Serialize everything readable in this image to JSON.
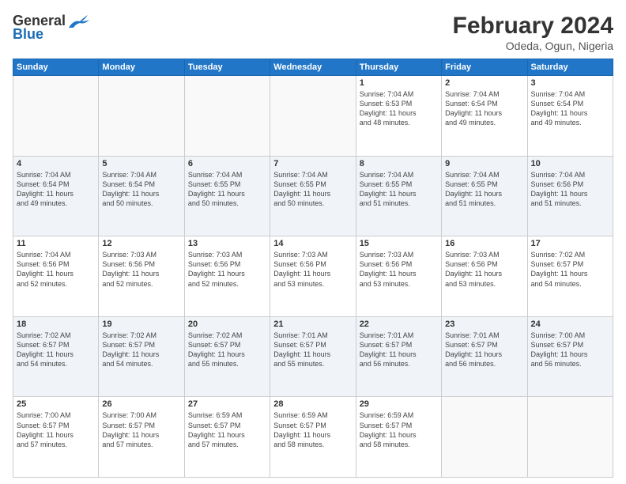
{
  "header": {
    "logo_general": "General",
    "logo_blue": "Blue",
    "title": "February 2024",
    "location": "Odeda, Ogun, Nigeria"
  },
  "weekdays": [
    "Sunday",
    "Monday",
    "Tuesday",
    "Wednesday",
    "Thursday",
    "Friday",
    "Saturday"
  ],
  "weeks": [
    [
      {
        "day": "",
        "info": ""
      },
      {
        "day": "",
        "info": ""
      },
      {
        "day": "",
        "info": ""
      },
      {
        "day": "",
        "info": ""
      },
      {
        "day": "1",
        "info": "Sunrise: 7:04 AM\nSunset: 6:53 PM\nDaylight: 11 hours\nand 48 minutes."
      },
      {
        "day": "2",
        "info": "Sunrise: 7:04 AM\nSunset: 6:54 PM\nDaylight: 11 hours\nand 49 minutes."
      },
      {
        "day": "3",
        "info": "Sunrise: 7:04 AM\nSunset: 6:54 PM\nDaylight: 11 hours\nand 49 minutes."
      }
    ],
    [
      {
        "day": "4",
        "info": "Sunrise: 7:04 AM\nSunset: 6:54 PM\nDaylight: 11 hours\nand 49 minutes."
      },
      {
        "day": "5",
        "info": "Sunrise: 7:04 AM\nSunset: 6:54 PM\nDaylight: 11 hours\nand 50 minutes."
      },
      {
        "day": "6",
        "info": "Sunrise: 7:04 AM\nSunset: 6:55 PM\nDaylight: 11 hours\nand 50 minutes."
      },
      {
        "day": "7",
        "info": "Sunrise: 7:04 AM\nSunset: 6:55 PM\nDaylight: 11 hours\nand 50 minutes."
      },
      {
        "day": "8",
        "info": "Sunrise: 7:04 AM\nSunset: 6:55 PM\nDaylight: 11 hours\nand 51 minutes."
      },
      {
        "day": "9",
        "info": "Sunrise: 7:04 AM\nSunset: 6:55 PM\nDaylight: 11 hours\nand 51 minutes."
      },
      {
        "day": "10",
        "info": "Sunrise: 7:04 AM\nSunset: 6:56 PM\nDaylight: 11 hours\nand 51 minutes."
      }
    ],
    [
      {
        "day": "11",
        "info": "Sunrise: 7:04 AM\nSunset: 6:56 PM\nDaylight: 11 hours\nand 52 minutes."
      },
      {
        "day": "12",
        "info": "Sunrise: 7:03 AM\nSunset: 6:56 PM\nDaylight: 11 hours\nand 52 minutes."
      },
      {
        "day": "13",
        "info": "Sunrise: 7:03 AM\nSunset: 6:56 PM\nDaylight: 11 hours\nand 52 minutes."
      },
      {
        "day": "14",
        "info": "Sunrise: 7:03 AM\nSunset: 6:56 PM\nDaylight: 11 hours\nand 53 minutes."
      },
      {
        "day": "15",
        "info": "Sunrise: 7:03 AM\nSunset: 6:56 PM\nDaylight: 11 hours\nand 53 minutes."
      },
      {
        "day": "16",
        "info": "Sunrise: 7:03 AM\nSunset: 6:56 PM\nDaylight: 11 hours\nand 53 minutes."
      },
      {
        "day": "17",
        "info": "Sunrise: 7:02 AM\nSunset: 6:57 PM\nDaylight: 11 hours\nand 54 minutes."
      }
    ],
    [
      {
        "day": "18",
        "info": "Sunrise: 7:02 AM\nSunset: 6:57 PM\nDaylight: 11 hours\nand 54 minutes."
      },
      {
        "day": "19",
        "info": "Sunrise: 7:02 AM\nSunset: 6:57 PM\nDaylight: 11 hours\nand 54 minutes."
      },
      {
        "day": "20",
        "info": "Sunrise: 7:02 AM\nSunset: 6:57 PM\nDaylight: 11 hours\nand 55 minutes."
      },
      {
        "day": "21",
        "info": "Sunrise: 7:01 AM\nSunset: 6:57 PM\nDaylight: 11 hours\nand 55 minutes."
      },
      {
        "day": "22",
        "info": "Sunrise: 7:01 AM\nSunset: 6:57 PM\nDaylight: 11 hours\nand 56 minutes."
      },
      {
        "day": "23",
        "info": "Sunrise: 7:01 AM\nSunset: 6:57 PM\nDaylight: 11 hours\nand 56 minutes."
      },
      {
        "day": "24",
        "info": "Sunrise: 7:00 AM\nSunset: 6:57 PM\nDaylight: 11 hours\nand 56 minutes."
      }
    ],
    [
      {
        "day": "25",
        "info": "Sunrise: 7:00 AM\nSunset: 6:57 PM\nDaylight: 11 hours\nand 57 minutes."
      },
      {
        "day": "26",
        "info": "Sunrise: 7:00 AM\nSunset: 6:57 PM\nDaylight: 11 hours\nand 57 minutes."
      },
      {
        "day": "27",
        "info": "Sunrise: 6:59 AM\nSunset: 6:57 PM\nDaylight: 11 hours\nand 57 minutes."
      },
      {
        "day": "28",
        "info": "Sunrise: 6:59 AM\nSunset: 6:57 PM\nDaylight: 11 hours\nand 58 minutes."
      },
      {
        "day": "29",
        "info": "Sunrise: 6:59 AM\nSunset: 6:57 PM\nDaylight: 11 hours\nand 58 minutes."
      },
      {
        "day": "",
        "info": ""
      },
      {
        "day": "",
        "info": ""
      }
    ]
  ]
}
